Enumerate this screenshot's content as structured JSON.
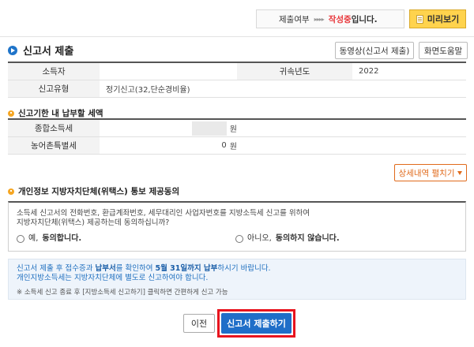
{
  "status": {
    "label": "제출여부",
    "arrows": "▸▸▸▸",
    "state": "작성중",
    "suffix": "입니다.",
    "preview_button": "미리보기"
  },
  "section": {
    "title": "신고서 제출",
    "video_button": "동영상(신고서 제출)",
    "help_button": "화면도움말"
  },
  "info": {
    "taxpayer_label": "소득자",
    "taxpayer_value": "",
    "year_label": "귀속년도",
    "year_value": "2022",
    "type_label": "신고유형",
    "type_value": "정기신고(32,단순경비율)"
  },
  "payment": {
    "title": "신고기한 내 납부할 세액",
    "income_tax_label": "종합소득세",
    "income_tax_unit": "원",
    "rural_tax_label": "농어촌특별세",
    "rural_tax_value": "0",
    "rural_tax_unit": "원",
    "detail_button": "상세내역 펼치기"
  },
  "consent": {
    "title": "개인정보 지방자치단체(위택스) 통보 제공동의",
    "text_line1": "소득세 신고서의 전화번호, 환급계좌번호, 세무대리인 사업자번호를 지방소득세 신고를 위하여",
    "text_line2": "지방자치단체(위택스) 제공하는데 동의하십니까?",
    "yes_prefix": "예, ",
    "yes_bold": "동의합니다.",
    "no_prefix": "아니오, ",
    "no_bold": "동의하지 않습니다."
  },
  "notice": {
    "line1_a": "신고서 제출 후 접수증과 ",
    "line1_b": "납부서",
    "line1_c": "를 확인하여 ",
    "line1_d": "5월 31일까지 납부",
    "line1_e": "하시기 바랍니다.",
    "line2": "개인지방소득세는 지방자치단체에 별도로 신고하여야 합니다.",
    "line3": "※ 소득세 신고 종료 후 [지방소득세 신고하기] 클릭하면 간편하게 신고 가능"
  },
  "buttons": {
    "prev": "이전",
    "submit": "신고서 제출하기"
  },
  "colors": {
    "accent_blue": "#1f6ec8",
    "highlight_red": "#e8141e",
    "status_red": "#e8373b",
    "preview_yellow": "#ffd34d",
    "detail_orange": "#e06a1b"
  }
}
